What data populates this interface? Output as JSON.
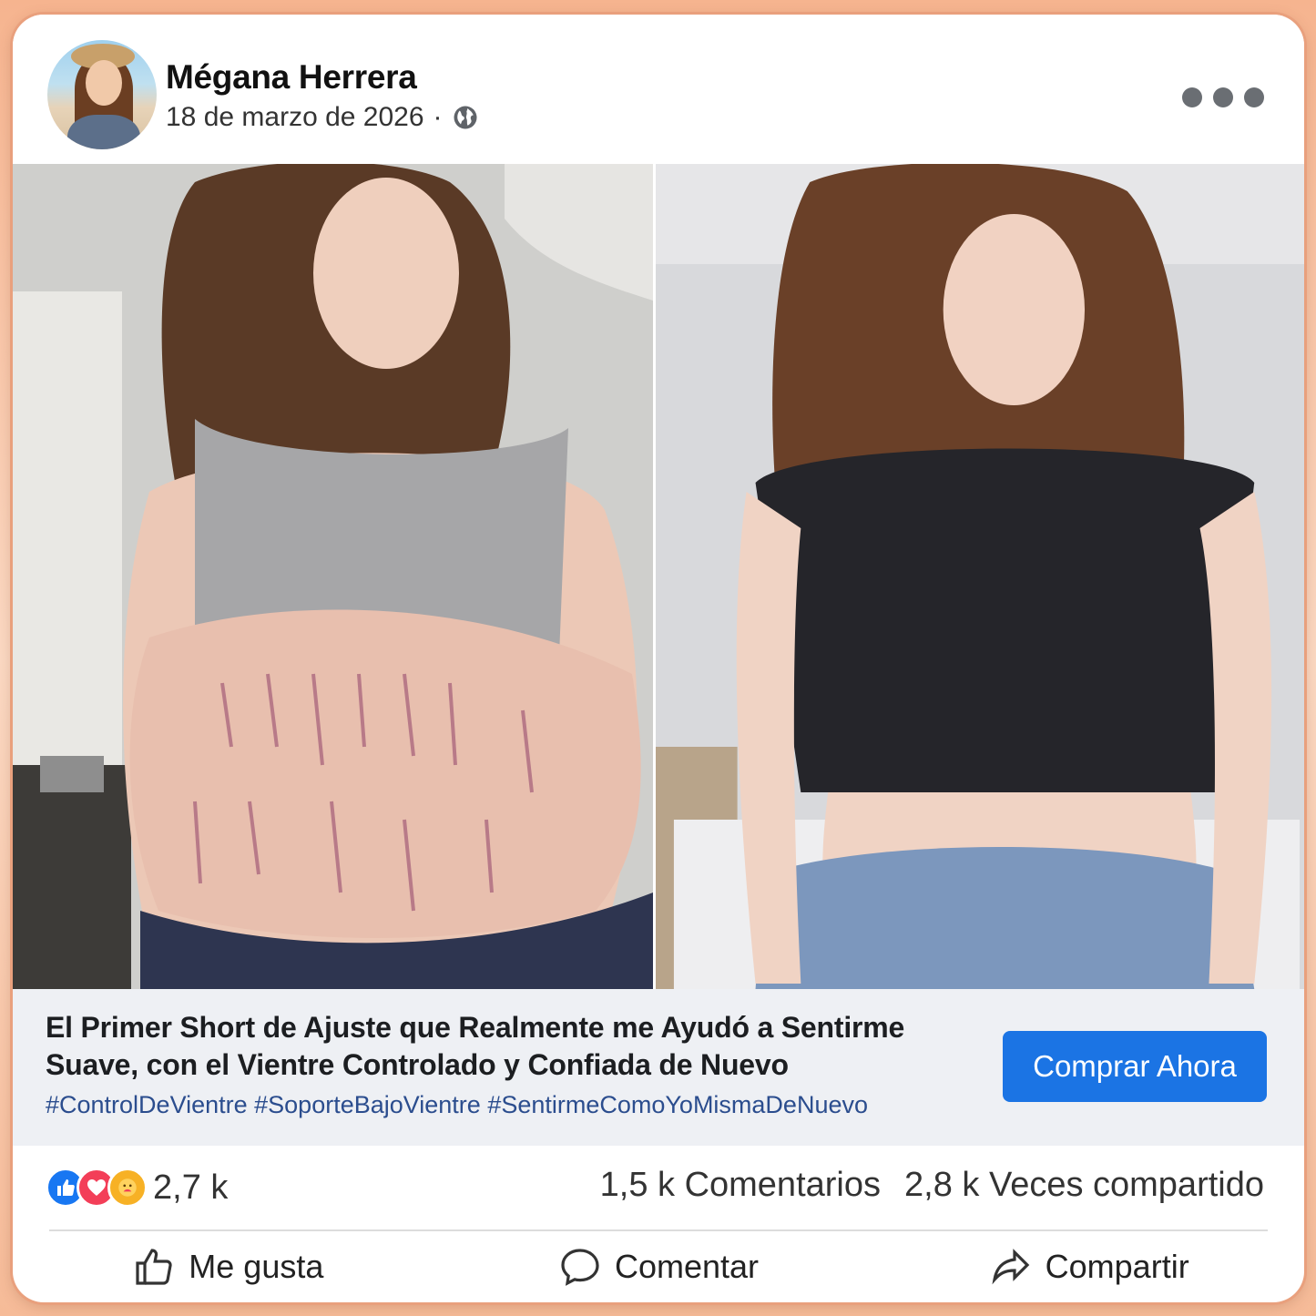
{
  "post": {
    "author": "Mégana Herrera",
    "date": "18 de marzo de 2026",
    "separator": "·",
    "privacy_icon": "globe-icon",
    "more_icon": "more-options-icon"
  },
  "ad": {
    "headline": "El Primer Short de Ajuste que Realmente me Ayudó a Sentirme Suave, con el Vientre Controlado y Confiada de Nuevo",
    "hashtags": "#ControlDeVientre #SoporteBajoVientre #SentirmeComoYoMismaDeNuevo",
    "cta_label": "Comprar Ahora",
    "cta_color": "#1b74e4"
  },
  "stats": {
    "reactions_count": "2,7 k",
    "reaction_icons": [
      "like-icon",
      "love-icon",
      "care-icon"
    ],
    "comments": "1,5 k Comentarios",
    "shares": "2,8 k Veces compartido"
  },
  "actions": {
    "like": "Me gusta",
    "comment": "Comentar",
    "share": "Compartir"
  },
  "colors": {
    "accent": "#1877f2",
    "frame": "#f6b48f",
    "hashtag": "#2b4d8e"
  }
}
